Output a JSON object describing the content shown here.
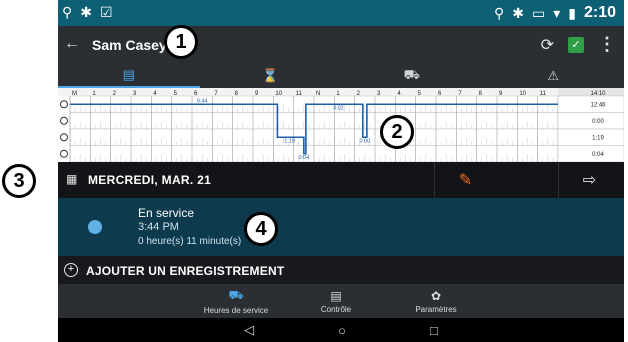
{
  "statusbar": {
    "left_icons": [
      "location-search-icon",
      "bluetooth-icon",
      "check-box-icon"
    ],
    "right_icons": [
      "location-pin-icon",
      "bluetooth-icon",
      "cast-icon",
      "wifi-icon",
      "battery-icon"
    ],
    "time": "2:10"
  },
  "titlebar": {
    "back_icon": "back-arrow-icon",
    "driver_name": "Sam Casey",
    "sync_icon": "sync-icon",
    "status_icon": "checked-icon",
    "menu_icon": "overflow-menu-icon"
  },
  "tabs": [
    {
      "icon": "clipboard-icon",
      "glyph": "▤",
      "active": true
    },
    {
      "icon": "hourglass-icon",
      "glyph": "⌛",
      "active": false
    },
    {
      "icon": "truck-icon",
      "glyph": "⛟",
      "active": false
    },
    {
      "icon": "warning-icon",
      "glyph": "⚠",
      "active": false
    }
  ],
  "graph": {
    "hour_labels": [
      "M",
      "1",
      "2",
      "3",
      "4",
      "5",
      "6",
      "7",
      "8",
      "9",
      "10",
      "11",
      "N",
      "1",
      "2",
      "3",
      "4",
      "5",
      "6",
      "7",
      "8",
      "9",
      "10",
      "11"
    ],
    "row_icons": [
      "off-duty-icon",
      "sleeper-icon",
      "driving-icon",
      "on-duty-icon"
    ],
    "segment_labels": [
      "9:44",
      "3:02",
      "1:19",
      "0:00",
      "0:04"
    ],
    "totals": {
      "header": "14:10",
      "rows": [
        "12:46",
        "0:00",
        "1:19",
        "0:04"
      ]
    }
  },
  "date": {
    "label": "MERCREDI, MAR. 21",
    "calendar_icon": "calendar-icon",
    "edit_icon": "edit-log-icon",
    "export_icon": "export-icon"
  },
  "record": {
    "status": "En service",
    "time": "3:44 PM",
    "duration": "0 heure(s) 11 minute(s)",
    "icon": "on-duty-status-icon"
  },
  "add_record": {
    "label": "AJOUTER UN ENREGISTREMENT",
    "icon": "add-circle-icon"
  },
  "bottomnav": [
    {
      "label": "Heures de service",
      "icon": "hours-of-service-icon",
      "active": true
    },
    {
      "label": "Contrôle",
      "icon": "inspection-icon",
      "active": false
    },
    {
      "label": "Paramètres",
      "icon": "settings-icon",
      "active": false
    }
  ],
  "sysbar": {
    "back": "◁",
    "home": "○",
    "recent": "□"
  },
  "callouts": [
    "1",
    "2",
    "3",
    "4"
  ],
  "colors": {
    "status_bar": "#0d5f73",
    "accent_blue": "#4ea6e6",
    "record_bg": "#0d3b4d",
    "edit_orange": "#f26e1a",
    "graph_line": "#1c5fa8"
  }
}
